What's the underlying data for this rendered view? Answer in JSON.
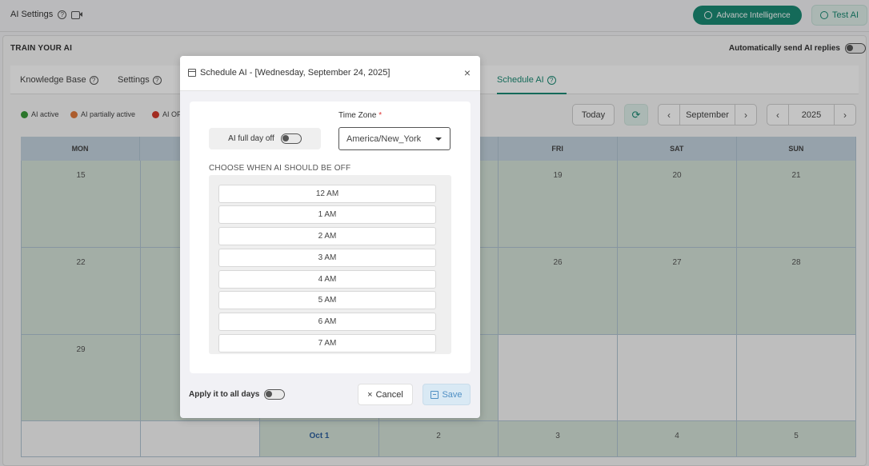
{
  "topbar": {
    "title": "AI Settings",
    "help_icon_glyph": "?",
    "advance_label": "Advance Intelligence",
    "test_label": "Test AI"
  },
  "train": {
    "title": "TRAIN YOUR AI",
    "auto_send_label": "Automatically send AI replies"
  },
  "tabs": {
    "knowledge": "Knowledge Base",
    "settings": "Settings",
    "schedule": "Schedule AI"
  },
  "legend": [
    {
      "label": "AI active",
      "color": "#3a9a3a"
    },
    {
      "label": "AI partially active",
      "color": "#e07a3c"
    },
    {
      "label": "AI OF",
      "color": "#d33a2c"
    }
  ],
  "controls": {
    "today": "Today",
    "refresh_glyph": "⟳",
    "month": "September",
    "year": "2025",
    "prev_glyph": "‹",
    "next_glyph": "›"
  },
  "calendar": {
    "headers": [
      "MON",
      "",
      "",
      "",
      "FRI",
      "SAT",
      "SUN"
    ],
    "rows": [
      [
        "15",
        "",
        "",
        "",
        "19",
        "20",
        "21"
      ],
      [
        "22",
        "",
        "",
        "",
        "26",
        "27",
        "28"
      ],
      [
        "29",
        "",
        "",
        "",
        "",
        "",
        ""
      ],
      [
        "",
        "",
        "Oct 1",
        "2",
        "3",
        "4",
        "5"
      ]
    ]
  },
  "modal": {
    "title": "Schedule AI - [Wednesday, September 24, 2025]",
    "close_glyph": "×",
    "time_zone_label": "Time Zone",
    "required_mark": "*",
    "full_day_label": "AI full day off",
    "time_zone_value": "America/New_York",
    "choose_label": "CHOOSE WHEN AI SHOULD BE OFF",
    "slots": [
      "12 AM",
      "1 AM",
      "2 AM",
      "3 AM",
      "4 AM",
      "5 AM",
      "6 AM",
      "7 AM"
    ],
    "apply_label": "Apply it to all days",
    "cancel_label": "Cancel",
    "cancel_glyph": "×",
    "save_label": "Save"
  },
  "colors": {
    "brand": "#1b8a74",
    "calendar_active": "#d5e3d8",
    "calendar_header": "#c3d3df"
  }
}
